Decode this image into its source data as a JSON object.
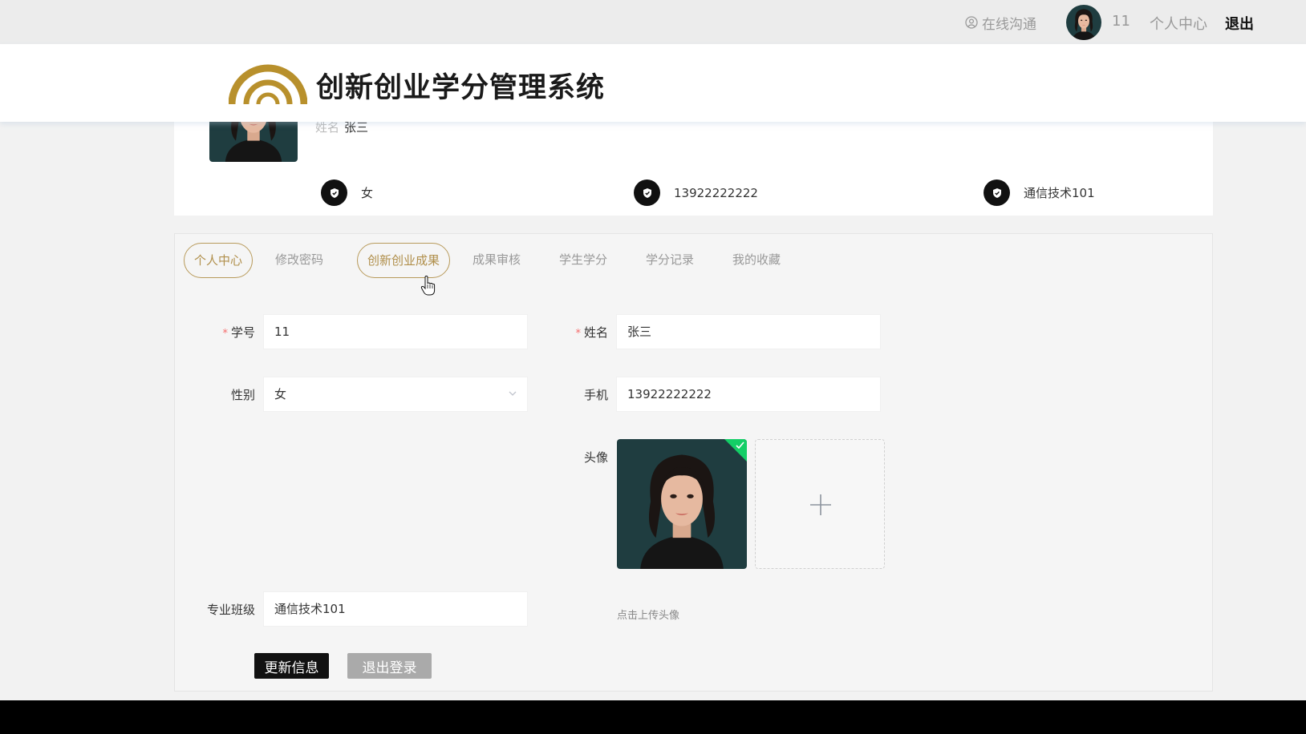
{
  "topbar": {
    "chat_label": "在线沟通",
    "username": "11",
    "center_label": "个人中心",
    "logout_label": "退出"
  },
  "header": {
    "title": "创新创业学分管理系统",
    "logo_color": "#b8902c"
  },
  "profile": {
    "name_label": "姓名",
    "name": "张三",
    "gender": "女",
    "phone": "13922222222",
    "class": "通信技术101"
  },
  "tabs": [
    {
      "label": "个人中心"
    },
    {
      "label": "修改密码"
    },
    {
      "label": "创新创业成果"
    },
    {
      "label": "成果审核"
    },
    {
      "label": "学生学分"
    },
    {
      "label": "学分记录"
    },
    {
      "label": "我的收藏"
    }
  ],
  "form": {
    "student_id_label": "学号",
    "student_id": "11",
    "name_label": "姓名",
    "name": "张三",
    "gender_label": "性别",
    "gender": "女",
    "phone_label": "手机",
    "phone": "13922222222",
    "avatar_label": "头像",
    "upload_hint": "点击上传头像",
    "class_label": "专业班级",
    "class": "通信技术101",
    "required_mark": "*"
  },
  "buttons": {
    "update": "更新信息",
    "logout": "退出登录"
  },
  "colors": {
    "accent": "#b08f4b",
    "success": "#13ce66"
  }
}
